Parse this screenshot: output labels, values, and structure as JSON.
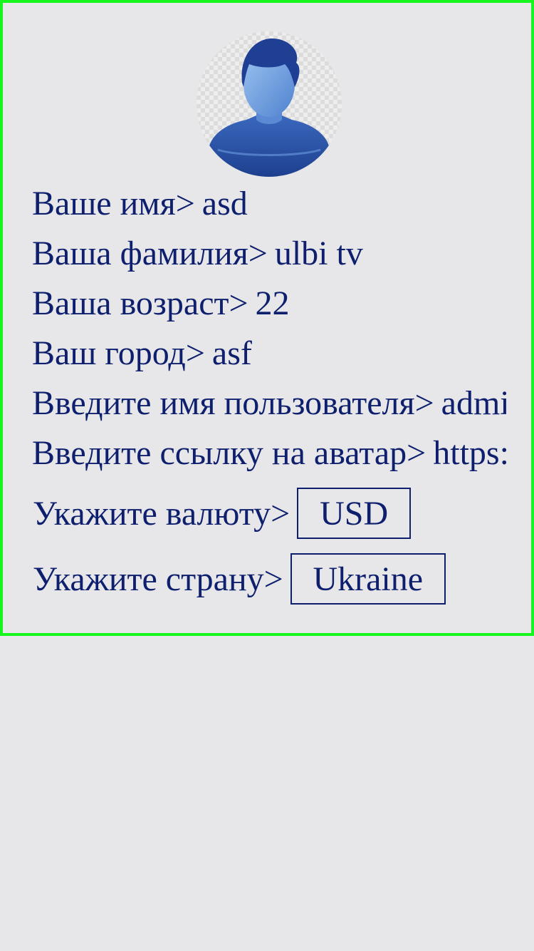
{
  "profile": {
    "fields": [
      {
        "label": "Ваше имя>",
        "value": "asd"
      },
      {
        "label": "Ваша фамилия>",
        "value": "ulbi tv"
      },
      {
        "label": "Ваша возраст>",
        "value": "22"
      },
      {
        "label": "Ваш город>",
        "value": "asf"
      },
      {
        "label": "Введите имя пользователя>",
        "value": "admin"
      },
      {
        "label": "Введите ссылку на аватар>",
        "value": "https://"
      }
    ],
    "currency": {
      "label": "Укажите валюту>",
      "selected": "USD"
    },
    "country": {
      "label": "Укажите страну>",
      "selected": "Ukraine"
    }
  },
  "icons": {
    "avatar": "user-silhouette-icon"
  },
  "colors": {
    "text": "#0e1f6e",
    "border": "#17f51e",
    "background": "#e7e7e9"
  }
}
